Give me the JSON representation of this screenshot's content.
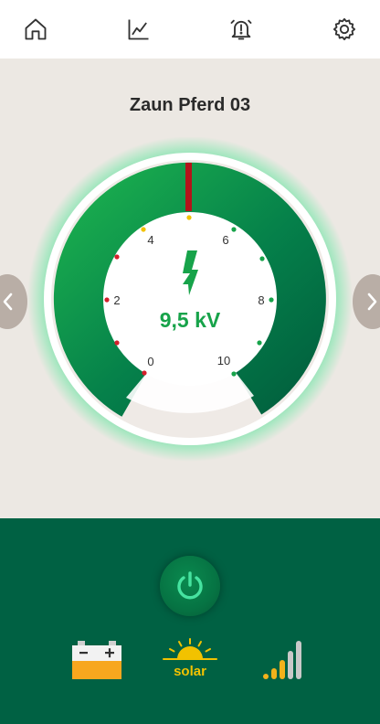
{
  "nav": {
    "items": [
      {
        "name": "home-icon"
      },
      {
        "name": "chart-icon"
      },
      {
        "name": "alarm-icon"
      },
      {
        "name": "settings-icon"
      }
    ]
  },
  "device": {
    "title": "Zaun Pferd 03"
  },
  "gauge": {
    "value_text": "9,5 kV",
    "scale_labels": [
      "0",
      "2",
      "4",
      "6",
      "8",
      "10"
    ],
    "colors": {
      "ring_light": "#22b24c",
      "ring_dark": "#006141",
      "value": "#17a34a",
      "marker": "#b3141a"
    }
  },
  "status": {
    "battery": {
      "icon": "battery-icon",
      "color": "#f7a71e"
    },
    "solar": {
      "icon": "solar-icon",
      "label": "solar",
      "color": "#f2c200"
    },
    "signal": {
      "icon": "signal-icon",
      "level": 0.6,
      "color": "#f2b21b"
    }
  },
  "colors": {
    "panel": "#006143",
    "background": "#ece8e3"
  }
}
